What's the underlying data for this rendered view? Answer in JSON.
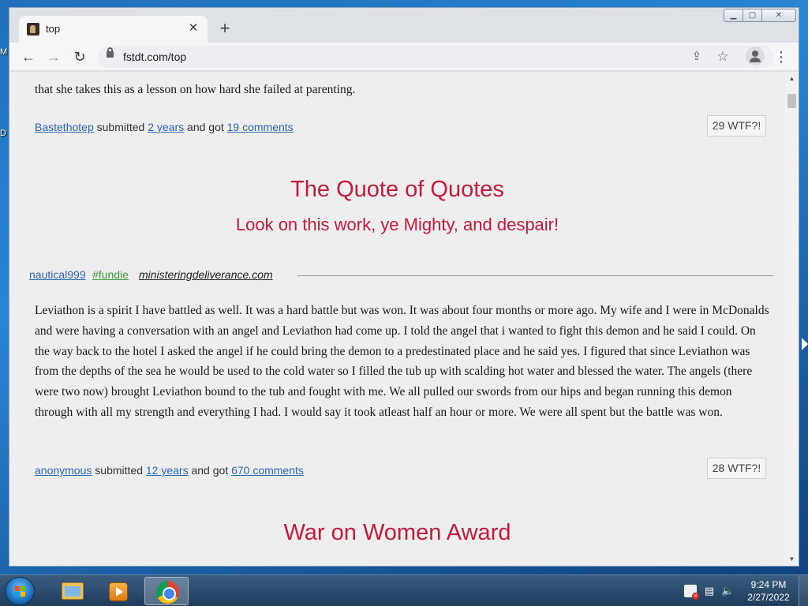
{
  "desktop": {
    "fragment_top": "M",
    "fragment_mid": "D"
  },
  "browser": {
    "tab": {
      "title": "top",
      "close_glyph": "✕"
    },
    "new_tab_glyph": "+",
    "address": "fstdt.com/top",
    "nav": {
      "back_glyph": "←",
      "forward_glyph": "→",
      "reload_glyph": "↻"
    },
    "share_glyph": "⇪",
    "bookmark_glyph": "☆",
    "menu_glyph": "⋮",
    "window_controls": {
      "minimize": "▁",
      "maximize": "▢",
      "close": "✕"
    }
  },
  "page": {
    "prev_post": {
      "text_tail": "that she takes this as a lesson on how hard she failed at parenting.",
      "author": "Bastethotep",
      "submitted_label": "submitted",
      "age": "2 years",
      "and_got": "and got",
      "comments": "19 comments",
      "wtf": "29 WTF?!"
    },
    "award1": {
      "title": "The Quote of Quotes",
      "subtitle": "Look on this work, ye Mighty, and despair!"
    },
    "post": {
      "user": "nautical999",
      "category": "#fundie",
      "site": "ministeringdeliverance.com",
      "text": "Leviathon is a spirit I have battled as well. It was a hard battle but was won. It was about four months or more ago. My wife and I were in McDonalds and were having a conversation with an angel and Leviathon had come up. I told the angel that i wanted to fight this demon and he said I could. On the way back to the hotel I asked the angel if he could bring the demon to a predestinated place and he said yes. I figured that since Leviathon was from the depths of the sea he would be used to the cold water so I filled the tub up with scalding hot water and blessed the water. The angels (there were two now) brought Leviathon bound to the tub and fought with me. We all pulled our swords from our hips and began running this demon through with all my strength and everything I had. I would say it took atleast half an hour or more. We were all spent but the battle was won.",
      "author": "anonymous",
      "submitted_label": "submitted",
      "age": "12 years",
      "and_got": "and got",
      "comments": "670 comments",
      "wtf": "28 WTF?!"
    },
    "award2": {
      "title": "War on Women Award"
    }
  },
  "taskbar": {
    "time": "9:24 PM",
    "date": "2/27/2022"
  },
  "colors": {
    "award_heading": "#c41a3e",
    "link": "#2c64b4",
    "category": "#3e9a3e",
    "page_bg": "#eeeeee"
  },
  "icons": [
    "favicon-icon",
    "close-icon",
    "plus-icon",
    "back-arrow-icon",
    "forward-arrow-icon",
    "reload-icon",
    "lock-icon",
    "share-icon",
    "star-icon",
    "profile-icon",
    "kebab-menu-icon",
    "windows-start-icon",
    "file-explorer-icon",
    "media-player-icon",
    "chrome-icon",
    "action-center-flag-icon",
    "network-icon",
    "volume-icon"
  ]
}
